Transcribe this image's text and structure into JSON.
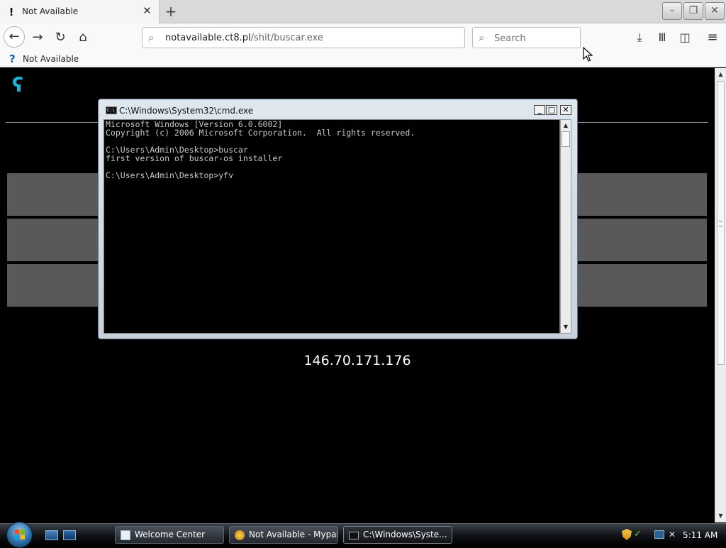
{
  "browser": {
    "tab": {
      "title": "Not Available"
    },
    "url": {
      "host": "notavailable.ct8.pl",
      "path": "/shit/buscar.exe"
    },
    "search": {
      "placeholder": "Search"
    },
    "bookmarks": [
      {
        "label": "Not Available"
      }
    ]
  },
  "icons": {
    "tab_alert": "!",
    "close": "✕",
    "plus": "+",
    "back": "←",
    "forward": "→",
    "reload": "↻",
    "home": "⌂",
    "search": "⌕",
    "download": "⤓",
    "library": "Ⅲ",
    "sidebar": "◫",
    "menu": "≡",
    "bookmark": "?",
    "min": "–",
    "max": "❐",
    "win_close": "✕",
    "arrow_up": "▲",
    "arrow_down": "▼",
    "site_logo": "ʕ"
  },
  "page": {
    "ip": "146.70.171.176"
  },
  "cmd_window": {
    "title": "C:\\Windows\\System32\\cmd.exe",
    "icon_text": "C:\\",
    "buttons": {
      "min": "_",
      "max": "□",
      "close": "✕"
    },
    "lines": [
      "Microsoft Windows [Version 6.0.6002]",
      "Copyright (c) 2006 Microsoft Corporation.  All rights reserved.",
      "",
      "C:\\Users\\Admin\\Desktop>buscar",
      "first version of buscar-os installer",
      "",
      "C:\\Users\\Admin\\Desktop>yfv"
    ]
  },
  "taskbar": {
    "tasks": [
      {
        "label": "Welcome Center"
      },
      {
        "label": "Not Available - Mypal"
      },
      {
        "label": "C:\\Windows\\Syste..."
      }
    ],
    "tray": {
      "check": "✓",
      "volume": "✕",
      "time": "5:11 AM"
    }
  },
  "colors": {
    "page_bg": "#000000",
    "block_gray": "#595959",
    "logo_cyan": "#1ab5d8",
    "console_text": "#c8c8c8"
  }
}
